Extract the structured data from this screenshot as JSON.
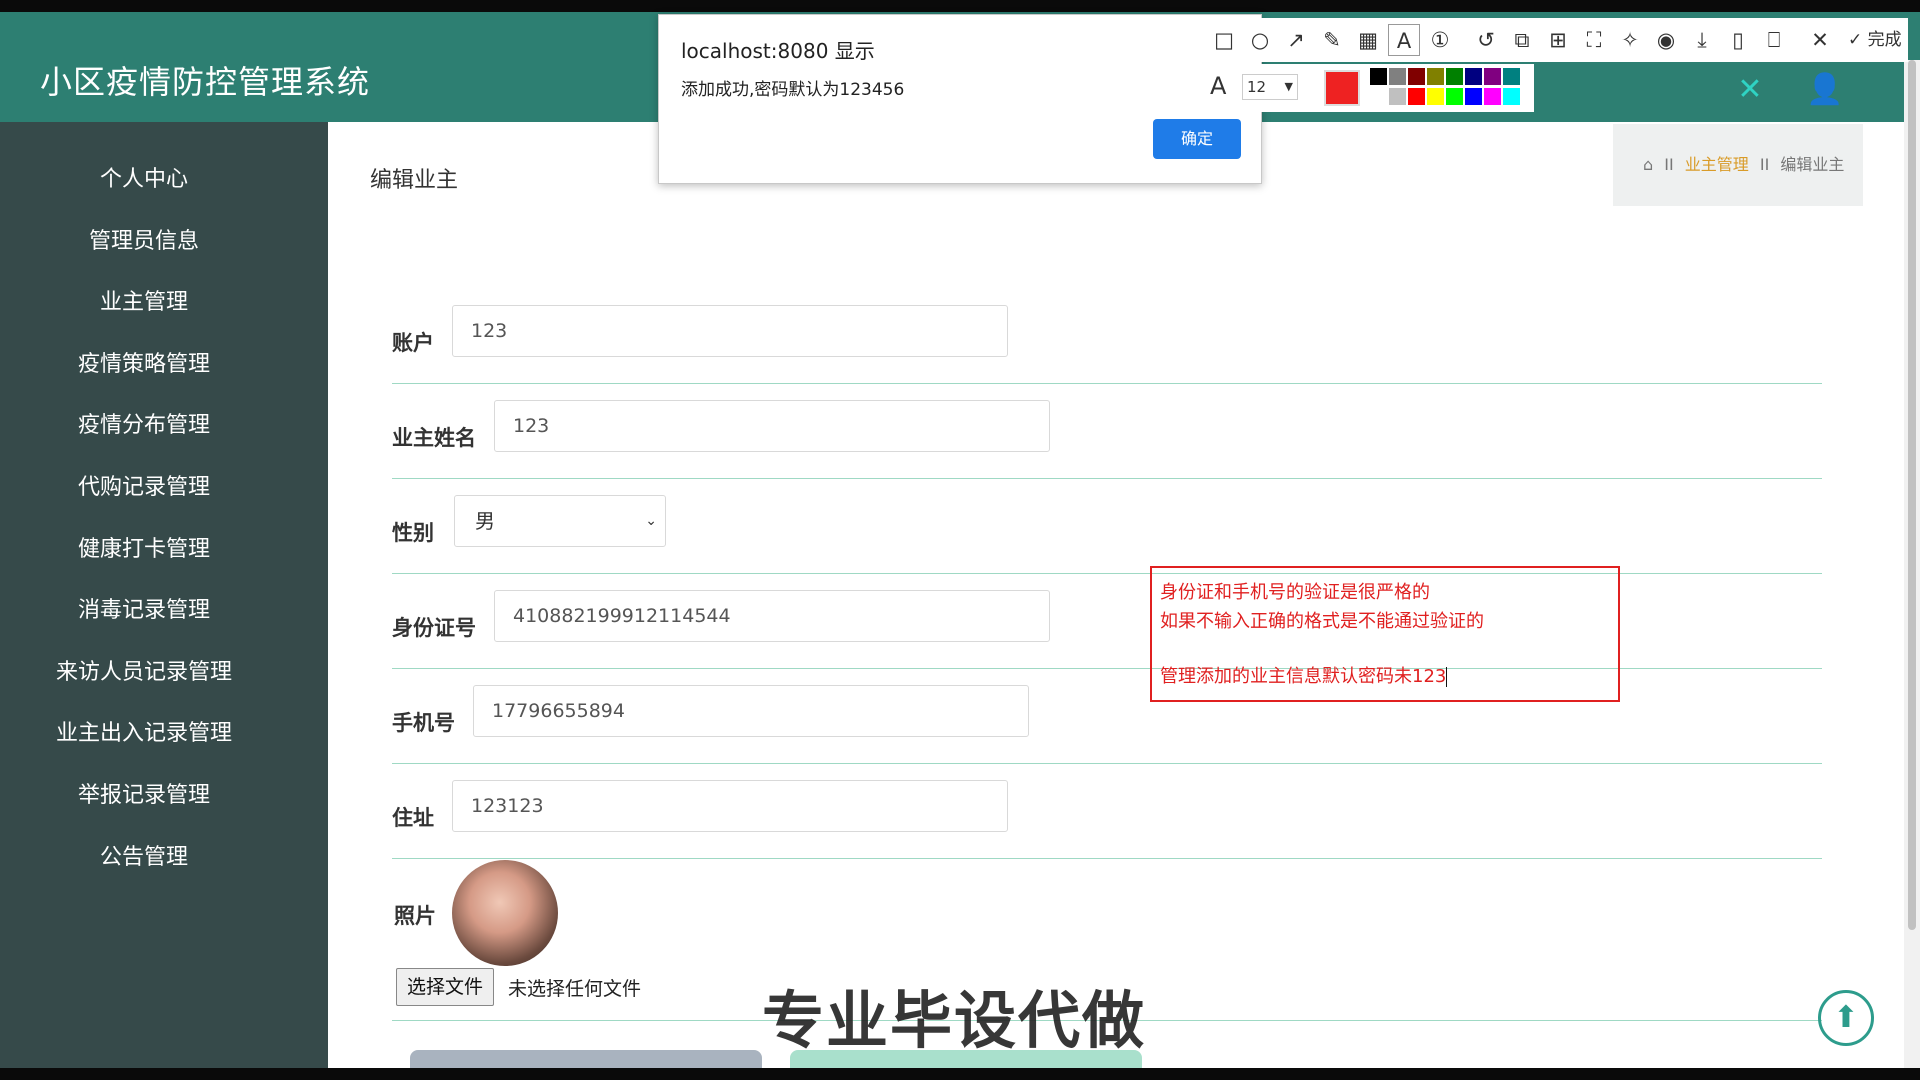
{
  "app": {
    "title": "小区疫情防控管理系统"
  },
  "sidebar": {
    "items": [
      {
        "label": "个人中心"
      },
      {
        "label": "管理员信息"
      },
      {
        "label": "业主管理"
      },
      {
        "label": "疫情策略管理"
      },
      {
        "label": "疫情分布管理"
      },
      {
        "label": "代购记录管理"
      },
      {
        "label": "健康打卡管理"
      },
      {
        "label": "消毒记录管理"
      },
      {
        "label": "来访人员记录管理"
      },
      {
        "label": "业主出入记录管理"
      },
      {
        "label": "举报记录管理"
      },
      {
        "label": "公告管理"
      }
    ]
  },
  "page": {
    "title": "编辑业主",
    "breadcrumb": {
      "home_icon": "home-icon",
      "sep": "II",
      "parent": "业主管理",
      "current": "编辑业主"
    }
  },
  "form": {
    "account_label": "账户",
    "account_value": "123",
    "name_label": "业主姓名",
    "name_value": "123",
    "gender_label": "性别",
    "gender_value": "男",
    "idcard_label": "身份证号",
    "idcard_value": "410882199912114544",
    "phone_label": "手机号",
    "phone_value": "17796655894",
    "address_label": "住址",
    "address_value": "123123",
    "photo_label": "照片",
    "file_button": "选择文件",
    "file_status": "未选择任何文件"
  },
  "dialog": {
    "title": "localhost:8080 显示",
    "message": "添加成功,密码默认为123456",
    "ok": "确定"
  },
  "annotation": {
    "line1": "身份证和手机号的验证是很严格的",
    "line2": "如果不输入正确的格式是不能通过验证的",
    "line3": "管理添加的业主信息默认密码未123"
  },
  "toolbar": {
    "font_size": "12",
    "done": "完成",
    "current_color": "#ee2222",
    "swatches": [
      "#000000",
      "#808080",
      "#800000",
      "#808000",
      "#008000",
      "#000080",
      "#800080",
      "#008080",
      "#ffffff",
      "#c0c0c0",
      "#ff0000",
      "#ffff00",
      "#00ff00",
      "#0000ff",
      "#ff00ff",
      "#00ffff"
    ]
  },
  "watermark": "专业毕设代做",
  "colors": {
    "header": "#2d7f72",
    "sidebar": "#364a4a",
    "divider": "#9fd9c4",
    "annotation": "#e02020"
  }
}
